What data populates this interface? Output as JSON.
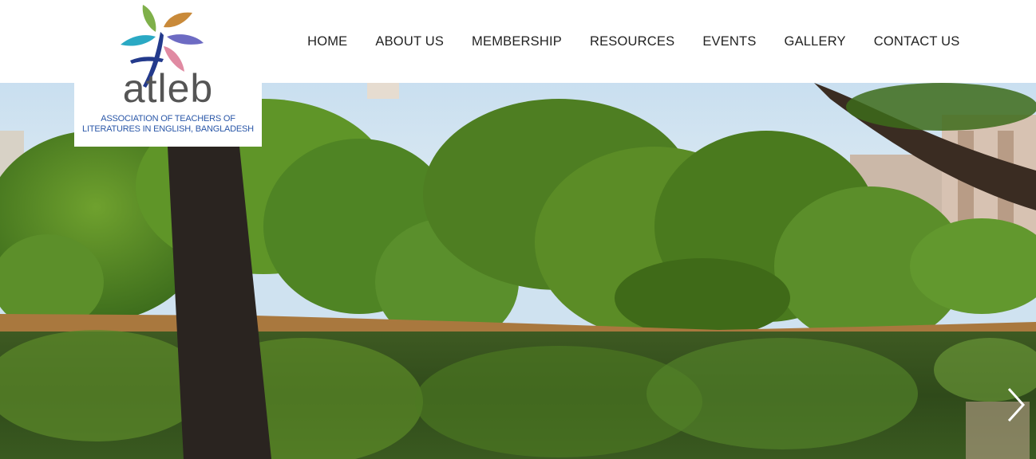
{
  "logo": {
    "wordmark": "atleb",
    "tagline_line1": "ASSOCIATION OF TEACHERS OF",
    "tagline_line2": "LITERATURES IN ENGLISH, BANGLADESH",
    "leaf_colors": [
      "#7fb04a",
      "#c98a3a",
      "#2aa9c4",
      "#6d6bc3",
      "#e08aa2"
    ],
    "figure_color": "#233a8c"
  },
  "nav": {
    "items": [
      {
        "label": "HOME"
      },
      {
        "label": "ABOUT US"
      },
      {
        "label": "MEMBERSHIP"
      },
      {
        "label": "RESOURCES"
      },
      {
        "label": "EVENTS"
      },
      {
        "label": "GALLERY"
      },
      {
        "label": "CONTACT US"
      }
    ]
  },
  "hero": {
    "scene": "lake-with-trees-photo",
    "next_icon": "chevron-right-icon"
  }
}
